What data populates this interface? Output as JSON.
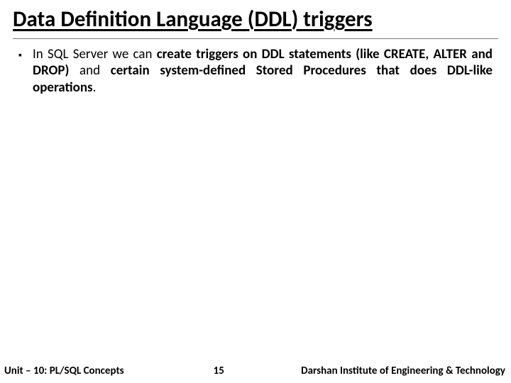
{
  "title": "Data Definition Language (DDL) triggers",
  "bullet": {
    "lead": "In SQL Server we can ",
    "bold1": "create triggers on DDL statements (like CREATE, ALTER and DROP) ",
    "mid": "and ",
    "bold2": "certain system-defined Stored Procedures that does DDL-like operations",
    "tail": "."
  },
  "footer": {
    "left": "Unit – 10: PL/SQL Concepts",
    "page": "15",
    "right": "Darshan Institute of Engineering & Technology"
  }
}
